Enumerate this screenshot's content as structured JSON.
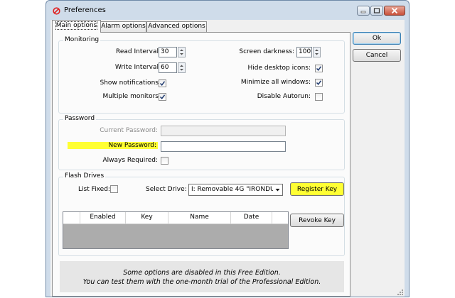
{
  "window": {
    "title": "Preferences",
    "colors": {
      "title_icon": "#e02020",
      "highlight": "#ffff33",
      "close_button": "#c9503a"
    },
    "icons": {
      "app": "no-entry-icon",
      "minimize": "minimize-icon",
      "maximize": "maximize-icon",
      "close": "close-icon"
    }
  },
  "tabs": [
    {
      "label": "Main options",
      "active": true
    },
    {
      "label": "Alarm options",
      "active": false
    },
    {
      "label": "Advanced options",
      "active": false
    }
  ],
  "buttons": {
    "ok": "Ok",
    "cancel": "Cancel"
  },
  "monitoring": {
    "legend": "Monitoring",
    "read_interval": {
      "label": "Read Interval:",
      "value": "30"
    },
    "write_interval": {
      "label": "Write Interval:",
      "value": "60"
    },
    "show_notifications": {
      "label": "Show notifications:",
      "checked": true
    },
    "multiple_monitors": {
      "label": "Multiple monitors:",
      "checked": true
    },
    "screen_darkness": {
      "label": "Screen darkness:",
      "value": "100"
    },
    "hide_desktop_icons": {
      "label": "Hide desktop icons:",
      "checked": true
    },
    "minimize_all_windows": {
      "label": "Minimize all windows:",
      "checked": true
    },
    "disable_autorun": {
      "label": "Disable Autorun:",
      "checked": false
    }
  },
  "password": {
    "legend": "Password",
    "current_password": {
      "label": "Current Password:",
      "value": ""
    },
    "new_password": {
      "label": "New Password:",
      "value": ""
    },
    "always_required": {
      "label": "Always Required:",
      "checked": false
    }
  },
  "flash_drives": {
    "legend": "Flash Drives",
    "list_fixed": {
      "label": "List Fixed:",
      "checked": false
    },
    "select_drive": {
      "label": "Select Drive:",
      "value": "I: Removable 4G \"IRONDU"
    },
    "register_key": "Register Key",
    "revoke_key": "Revoke Key",
    "table": {
      "columns": [
        "Enabled",
        "Key",
        "Name",
        "Date"
      ],
      "rows": []
    }
  },
  "notice": {
    "line1": "Some options are disabled in this Free Edition.",
    "line2": "You can test them with the one-month trial of the Professional Edition."
  }
}
